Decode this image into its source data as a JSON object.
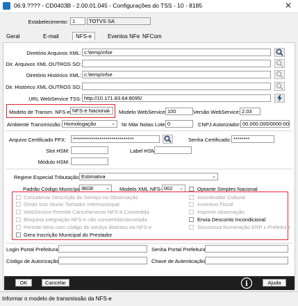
{
  "window": {
    "title": "06.9.???? - CD0403B - 2.00.01.045 - Configurações do TSS - 10 - 8185",
    "close": "✕"
  },
  "header": {
    "estab_label": "Estabelecimento:",
    "estab_code": "1",
    "estab_name": "TOTVS SA"
  },
  "tabs": [
    "Geral",
    "E-mail",
    "NFS-e",
    "Eventos NFe",
    "NFCom"
  ],
  "dirs": {
    "dir_xml_label": "Diretório Arquivos XML:",
    "dir_xml_value": "c:\\temp\\nfse",
    "dir_outros_label": "Dir. Arquivos XML OUTROS SO:",
    "dir_outros_value": "",
    "dir_hist_label": "Diretório Histórico XML:",
    "dir_hist_value": "c:\\temp\\nfse",
    "dir_hist_outros_label": "Dir. Histórico XML OUTROS SO:",
    "dir_hist_outros_value": "",
    "url_label": "URL WebService TSS:",
    "url_value": "http://10.171.83.64:8095/"
  },
  "transm": {
    "modelo_label": "Modelo de Transm. NFS-e:",
    "modelo_value": "NFS-e Nacional",
    "modelo_ws_label": "Modelo WebService:",
    "modelo_ws_value": "100",
    "versao_label": "Versão WebService:",
    "versao_value": "2.03",
    "ambiente_label": "Ambiente Transmissão:",
    "ambiente_value": "Homologação",
    "max_notas_label": "Nr Máx Notas Lote:",
    "max_notas_value": "0",
    "cnpj_label": "CNPJ Autorizador:",
    "cnpj_value": "00.000.000/0000-00"
  },
  "cert": {
    "pfx_label": "Arquivo Certificado PFX:",
    "pfx_value": "******************************",
    "senha_label": "Senha Certificado:",
    "senha_value": "********",
    "slot_label": "Slot HSM:",
    "slot_value": "",
    "label_hsm_label": "Label HSM:",
    "label_hsm_value": "",
    "modulo_label": "Módulo HSM:",
    "modulo_value": ""
  },
  "regime": {
    "regime_label": "Regime Especial Tributação:",
    "regime_value": "Estimativa",
    "padrao_label": "Padrão Código Município:",
    "padrao_value": "IBGE",
    "modelo_xml_label": "Modelo XML NFS-e:",
    "modelo_xml_value": "002",
    "optante_label": "Optante Simples Nacional"
  },
  "options_left": [
    "Concatenar Descrição do Serviço na Observação",
    "Omitir Insc Munic Tomador Intermunicipal",
    "WebService Permite Cancelamento NFS-e Convertida",
    "Bloqueia integração NFS-e não convertida/cancelada",
    "Permite itens com código de serviço distintos na NFS-e",
    "Gera Inscrição Municipal do Prestador"
  ],
  "options_right": [
    "Incentivador Cultural",
    "Incentivo Fiscal",
    "Imprimir observação",
    "Envia Desconto Incondicional",
    "Sincroniza Numeração ERP x Prefeitura"
  ],
  "login": {
    "login_label": "Login Portal Prefeitura:",
    "login_value": "",
    "senha_portal_label": "Senha Portal Prefeitura:",
    "senha_portal_value": "",
    "cod_aut_label": "Código de Autorização:",
    "cod_aut_value": "",
    "chave_label": "Chave de Autenticação:",
    "chave_value": ""
  },
  "buttons": {
    "ok": "OK",
    "cancel": "Cancelar",
    "help": "Ajuda"
  },
  "status": "Informar o modelo de transmissão da NFS-e",
  "colors": {
    "accent": "#1e73be",
    "highlight_border": "#e0242f",
    "bottom_bar": "#1f1f1f"
  }
}
